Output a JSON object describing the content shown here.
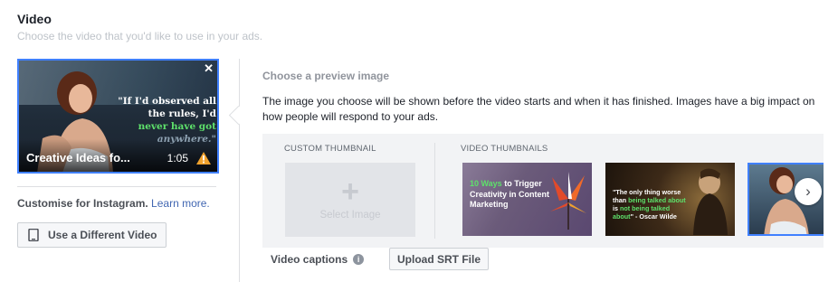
{
  "section": {
    "title": "Video",
    "subtitle": "Choose the video that you'd like to use in your ads."
  },
  "video_card": {
    "quote_part1": "\"If I'd observed all the rules, I'd ",
    "quote_highlight": "never have got",
    "quote_faded": "anywhere.\"",
    "close_glyph": "✕",
    "title": "Creative Ideas fo...",
    "duration": "1:05"
  },
  "instagram": {
    "text": "Customise for Instagram.",
    "link": "Learn more."
  },
  "use_different_video_label": "Use a Different Video",
  "preview": {
    "title": "Choose a preview image",
    "description": "The image you choose will be shown before the video starts and when it has finished. Images have a big impact on how people will respond to your ads.",
    "custom_label": "CUSTOM THUMBNAIL",
    "video_thumbs_label": "VIDEO THUMBNAILS",
    "plus_glyph": "+",
    "select_image_label": "Select Image",
    "thumb1_green": "10 Ways",
    "thumb1_white_a": "to",
    "thumb1_white_b": "Trigger Creativity in Content Marketing",
    "thumb2_a": "\"The only thing worse than ",
    "thumb2_green_a": "being talked about",
    "thumb2_b": " is ",
    "thumb2_green_b": "not being talked about",
    "thumb2_c": "\" - Oscar Wilde",
    "next_glyph": "›"
  },
  "captions": {
    "label": "Video captions",
    "info_glyph": "i",
    "upload_label": "Upload SRT File"
  },
  "colors": {
    "accent": "#4080ff",
    "link": "#4267b2",
    "highlight_green": "#5ee06b",
    "warning": "#f0a22e"
  }
}
